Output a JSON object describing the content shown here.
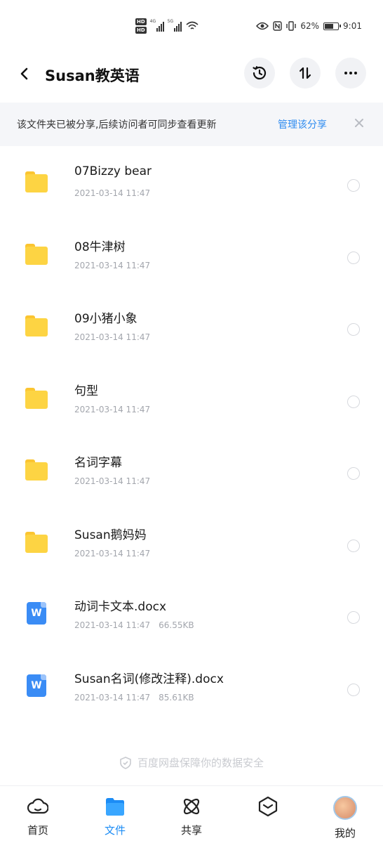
{
  "status_bar": {
    "battery_percent": "62%",
    "time": "9:01",
    "sim1_type": "4G",
    "sim2_type": "5G",
    "hd_label": "HD"
  },
  "header": {
    "title": "Susan教英语"
  },
  "notice": {
    "text": "该文件夹已被分享,后续访问者可同步查看更新",
    "link": "管理该分享"
  },
  "files": [
    {
      "type": "folder",
      "name": "07Bizzy bear",
      "date": "2021-03-14  11:47",
      "size": ""
    },
    {
      "type": "folder",
      "name": "08牛津树",
      "date": "2021-03-14  11:47",
      "size": ""
    },
    {
      "type": "folder",
      "name": "09小猪小象",
      "date": "2021-03-14  11:47",
      "size": ""
    },
    {
      "type": "folder",
      "name": "句型",
      "date": "2021-03-14  11:47",
      "size": ""
    },
    {
      "type": "folder",
      "name": "名词字幕",
      "date": "2021-03-14  11:47",
      "size": ""
    },
    {
      "type": "folder",
      "name": "Susan鹅妈妈",
      "date": "2021-03-14  11:47",
      "size": ""
    },
    {
      "type": "doc",
      "name": "动词卡文本.docx",
      "date": "2021-03-14  11:47",
      "size": "66.55KB"
    },
    {
      "type": "doc",
      "name": "Susan名词(修改注释).docx",
      "date": "2021-03-14  11:47",
      "size": "85.61KB"
    }
  ],
  "word_icon_letter": "W",
  "footer": {
    "safety_text": "百度网盘保障你的数据安全"
  },
  "tabbar": {
    "home": "首页",
    "files": "文件",
    "share": "共享",
    "me": "我的"
  },
  "colors": {
    "accent": "#1c8cf5",
    "folder": "#fdd443",
    "word": "#3a8cf5"
  }
}
